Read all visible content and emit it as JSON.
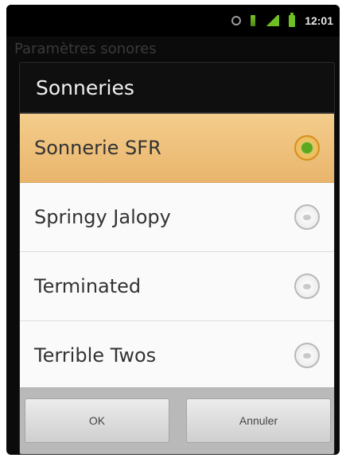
{
  "status_bar": {
    "time": "12:01",
    "icons": [
      "sync-icon",
      "wifi-icon",
      "signal-icon",
      "battery-icon"
    ]
  },
  "background": {
    "title": "Paramètres sonores"
  },
  "dialog": {
    "title": "Sonneries",
    "items": [
      {
        "label": "Sonnerie SFR",
        "selected": true
      },
      {
        "label": "Springy Jalopy",
        "selected": false
      },
      {
        "label": "Terminated",
        "selected": false
      },
      {
        "label": "Terrible Twos",
        "selected": false
      }
    ],
    "buttons": {
      "ok": "OK",
      "cancel": "Annuler"
    }
  },
  "colors": {
    "selected_row": "#f0c27c",
    "radio_selected": "#5ca820",
    "button_bar": "#b9b9b9"
  }
}
